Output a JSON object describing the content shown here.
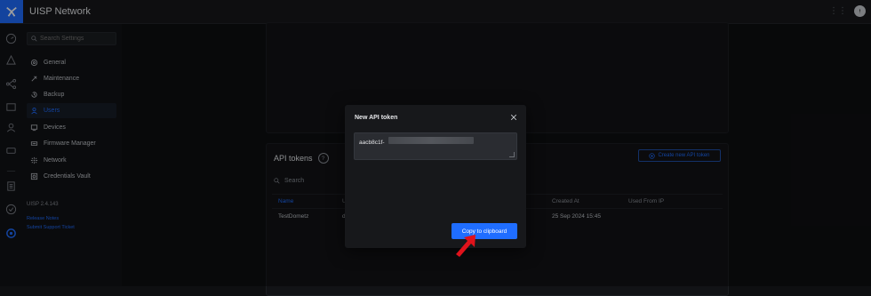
{
  "app": {
    "title": "UISP Network"
  },
  "sidebar": {
    "search_placeholder": "Search Settings",
    "items": [
      {
        "label": "General",
        "icon": "gear-icon"
      },
      {
        "label": "Maintenance",
        "icon": "wrench-icon"
      },
      {
        "label": "Backup",
        "icon": "history-icon"
      },
      {
        "label": "Users",
        "icon": "users-icon",
        "active": true
      },
      {
        "label": "Devices",
        "icon": "device-icon"
      },
      {
        "label": "Firmware Manager",
        "icon": "firmware-icon"
      },
      {
        "label": "Network",
        "icon": "network-icon"
      },
      {
        "label": "Credentials Vault",
        "icon": "vault-icon"
      }
    ],
    "version": "UISP 2.4.143",
    "links": [
      "Release Notes",
      "Submit Support Ticket"
    ]
  },
  "api_tokens": {
    "title": "API tokens",
    "create_button": "Create new API token",
    "search_placeholder": "Search",
    "columns": {
      "name": "Name",
      "col2": "U",
      "created": "Created At",
      "used_from": "Used From IP"
    },
    "rows": [
      {
        "name": "TestDometz",
        "col2": "d",
        "created_at": "25 Sep 2024 15:45"
      }
    ]
  },
  "modal": {
    "title": "New API token",
    "token_prefix": "aacb8c1f-",
    "copy_button": "Copy to clipboard"
  },
  "colors": {
    "accent": "#1f6dff",
    "pointer": "#e0121b",
    "background": "#0e0f11"
  }
}
